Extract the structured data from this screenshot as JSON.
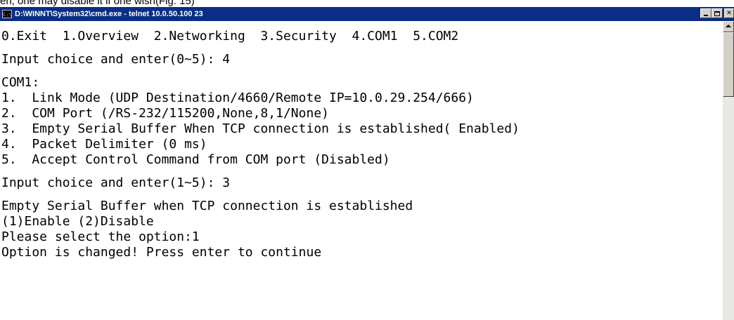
{
  "caption": "en, one may disable it if one wish(Fig. 15)",
  "window": {
    "title": "D:\\WINNT\\System32\\cmd.exe - telnet 10.0.50.100 23",
    "icon": "cmd-icon",
    "icon_text": "C:\\",
    "buttons": [
      "minimize",
      "maximize",
      "close"
    ],
    "close_glyph": "✕"
  },
  "console": {
    "menu_line": "0.Exit  1.Overview  2.Networking  3.Security  4.COM1  5.COM2",
    "prompt1": "Input choice and enter(0~5): 4",
    "section_title": "COM1:",
    "items": [
      "1.  Link Mode (UDP Destination/4660/Remote IP=10.0.29.254/666)",
      "2.  COM Port (/RS-232/115200,None,8,1/None)",
      "3.  Empty Serial Buffer When TCP connection is established( Enabled)",
      "4.  Packet Delimiter (0 ms)",
      "5.  Accept Control Command from COM port (Disabled)"
    ],
    "prompt2": "Input choice and enter(1~5): 3",
    "setting_title": "Empty Serial Buffer when TCP connection is established",
    "options": "(1)Enable (2)Disable",
    "select_prompt": "Please select the option:1",
    "confirm": "Option is changed! Press enter to continue"
  }
}
